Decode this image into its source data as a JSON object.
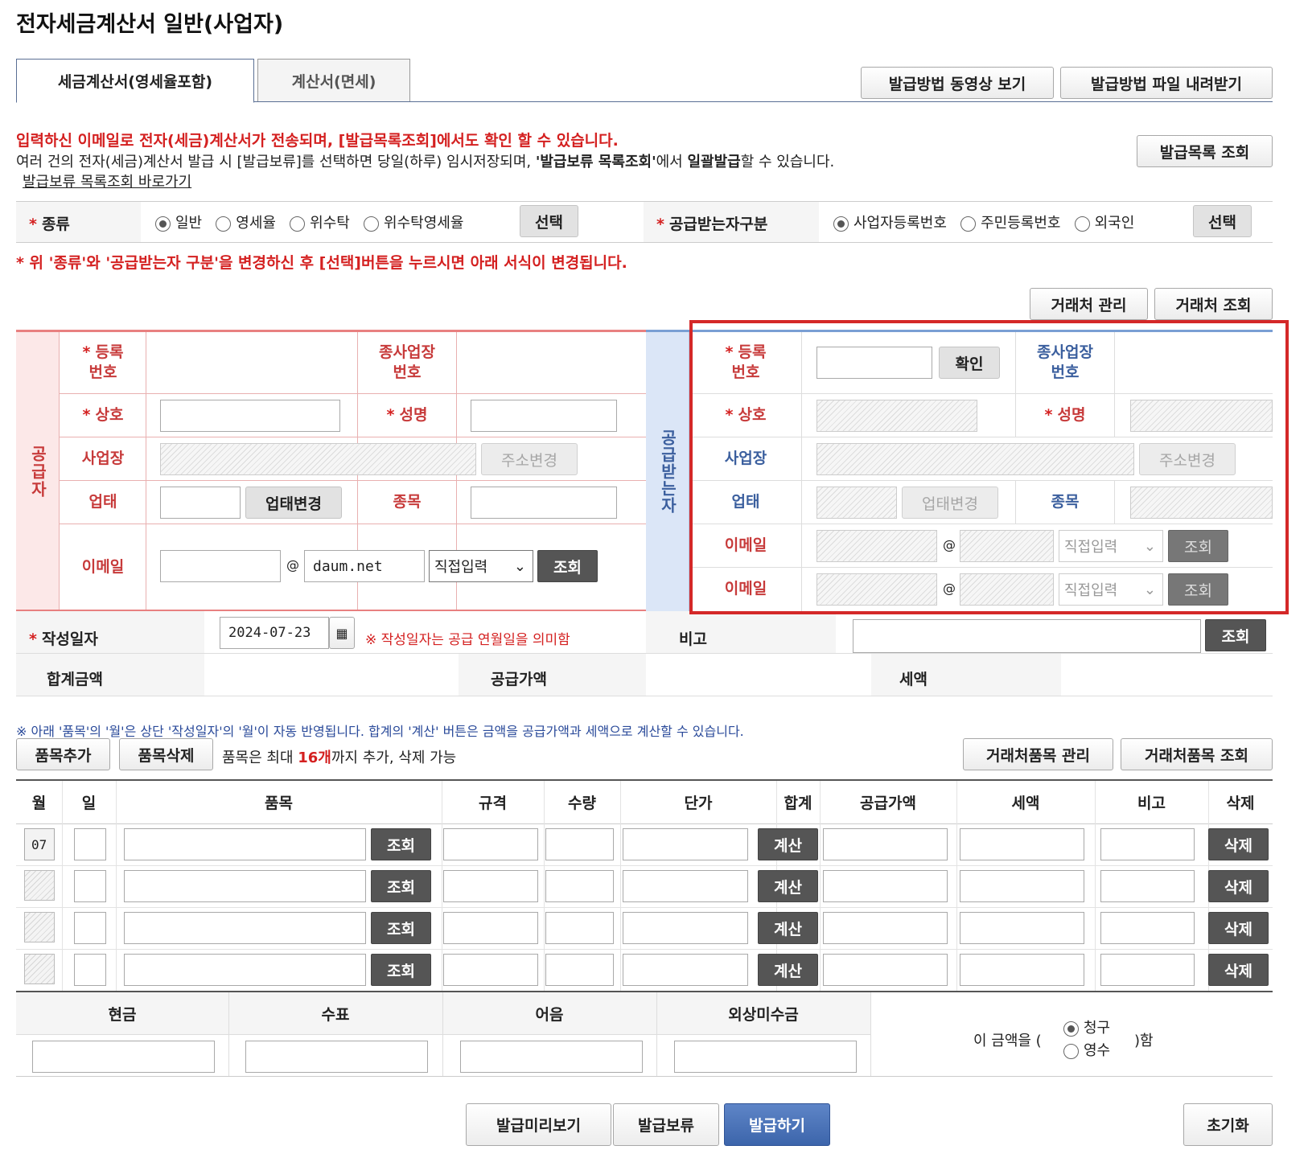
{
  "page_title": "전자세금계산서 일반(사업자)",
  "tabs": [
    {
      "label": "세금계산서(영세율포함)",
      "active": true
    },
    {
      "label": "계산서(면세)",
      "active": false
    }
  ],
  "top_buttons": {
    "video": "발급방법 동영상 보기",
    "download": "발급방법 파일 내려받기",
    "list": "발급목록 조회"
  },
  "notice": {
    "line1": "입력하신 이메일로 전자(세금)계산서가 전송되며, [발급목록조회]에서도 확인 할 수 있습니다.",
    "line2a": "여러 건의 전자(세금)계산서 발급 시 [발급보류]를 선택하면 당일(하루) 임시저장되며, ",
    "line2b": "'발급보류 목록조회'",
    "line2c": "에서 ",
    "line2d": "일괄발급",
    "line2e": "할 수 있습니다.",
    "link": "발급보류 목록조회 바로가기"
  },
  "kind": {
    "label": "종류",
    "options": [
      "일반",
      "영세율",
      "위수탁",
      "위수탁영세율"
    ],
    "selected": "일반",
    "button": "선택"
  },
  "recipient_type": {
    "label": "공급받는자구분",
    "options": [
      "사업자등록번호",
      "주민등록번호",
      "외국인"
    ],
    "selected": "사업자등록번호",
    "button": "선택"
  },
  "change_notice": "* 위 '종류'와 '공급받는자 구분'을 변경하신 후 [선택]버튼을 누르시면 아래 서식이 변경됩니다.",
  "partner_buttons": {
    "manage": "거래처 관리",
    "search": "거래처 조회"
  },
  "supplier": {
    "side_label": "공급자",
    "reg_no": "등록\n번호",
    "sub_no": "종사업장\n번호",
    "name": "상호",
    "rep": "성명",
    "address": "사업장",
    "address_btn": "주소변경",
    "biz_type": "업태",
    "biz_btn": "업태변경",
    "item": "종목",
    "email": "이메일",
    "email_domain": "daum.net",
    "email_select": "직접입력",
    "email_btn": "조회"
  },
  "receiver": {
    "side_label": "공급받는자",
    "reg_no": "등록\n번호",
    "confirm_btn": "확인",
    "sub_no": "종사업장\n번호",
    "name": "상호",
    "rep": "성명",
    "address": "사업장",
    "address_btn": "주소변경",
    "biz_type": "업태",
    "biz_btn": "업태변경",
    "item": "종목",
    "email1": "이메일",
    "email2": "이메일",
    "email_select": "직접입력",
    "email_btn": "조회",
    "at": "@"
  },
  "date": {
    "label": "작성일자",
    "value": "2024-07-23",
    "note": "※ 작성일자는 공급 연월일을 의미함"
  },
  "remark": {
    "label": "비고",
    "btn": "조회"
  },
  "totals": {
    "total": "합계금액",
    "supply": "공급가액",
    "tax": "세액"
  },
  "item_notice": "※ 아래 '품목'의 '월'은 상단 '작성일자'의 '월'이 자동 반영됩니다. 합계의 '계산' 버튼은 금액을 공급가액과 세액으로 계산할 수 있습니다.",
  "item_controls": {
    "add": "품목추가",
    "del": "품목삭제",
    "limit_a": "품목은 최대 ",
    "limit_b": "16개",
    "limit_c": "까지 추가, 삭제 가능",
    "manage": "거래처품목 관리",
    "search": "거래처품목 조회"
  },
  "item_headers": [
    "월",
    "일",
    "품목",
    "규격",
    "수량",
    "단가",
    "합계",
    "공급가액",
    "세액",
    "비고",
    "삭제"
  ],
  "item_rows": [
    {
      "month": "07",
      "search": "조회",
      "calc": "계산",
      "delete": "삭제"
    },
    {
      "month": "",
      "search": "조회",
      "calc": "계산",
      "delete": "삭제"
    },
    {
      "month": "",
      "search": "조회",
      "calc": "계산",
      "delete": "삭제"
    },
    {
      "month": "",
      "search": "조회",
      "calc": "계산",
      "delete": "삭제"
    }
  ],
  "payment": {
    "headers": [
      "현금",
      "수표",
      "어음",
      "외상미수금"
    ],
    "prefix": "이 금액을 (",
    "options": [
      "청구",
      "영수"
    ],
    "selected": "청구",
    "suffix": ")함"
  },
  "bottom_buttons": {
    "preview": "발급미리보기",
    "hold": "발급보류",
    "issue": "발급하기",
    "reset": "초기화"
  }
}
